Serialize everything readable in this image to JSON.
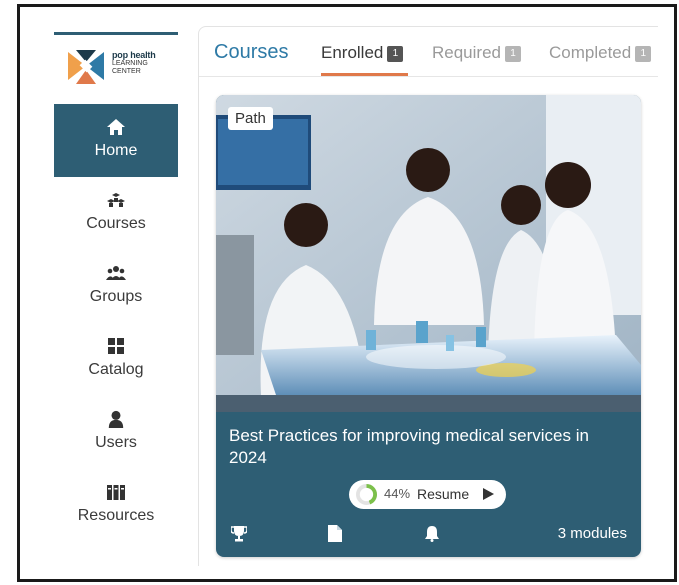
{
  "app": {
    "logo": {
      "line1": "pop health",
      "line2": "LEARNING",
      "line3": "CENTER"
    }
  },
  "sidebar": {
    "items": [
      {
        "label": "Home",
        "icon": "home-icon",
        "active": true
      },
      {
        "label": "Courses",
        "icon": "courses-icon",
        "active": false
      },
      {
        "label": "Groups",
        "icon": "groups-icon",
        "active": false
      },
      {
        "label": "Catalog",
        "icon": "catalog-icon",
        "active": false
      },
      {
        "label": "Users",
        "icon": "user-icon",
        "active": false
      },
      {
        "label": "Resources",
        "icon": "resources-icon",
        "active": false
      }
    ]
  },
  "main": {
    "section_title": "Courses",
    "tabs": [
      {
        "label": "Enrolled",
        "count": "1",
        "active": true
      },
      {
        "label": "Required",
        "count": "1",
        "active": false
      },
      {
        "label": "Completed",
        "count": "1",
        "active": false
      }
    ],
    "card": {
      "tag": "Path",
      "title": "Best Practices for improving medical services in 2024",
      "progress_percent": 44,
      "progress_label": "44%",
      "resume_label": "Resume",
      "modules_label": "3 modules",
      "footer_icons": [
        "trophy-icon",
        "document-icon",
        "bell-icon"
      ]
    }
  },
  "colors": {
    "brand": "#2e5e74",
    "accent": "#e0794a",
    "link": "#2e7aa6",
    "progress": "#7cc04b"
  }
}
